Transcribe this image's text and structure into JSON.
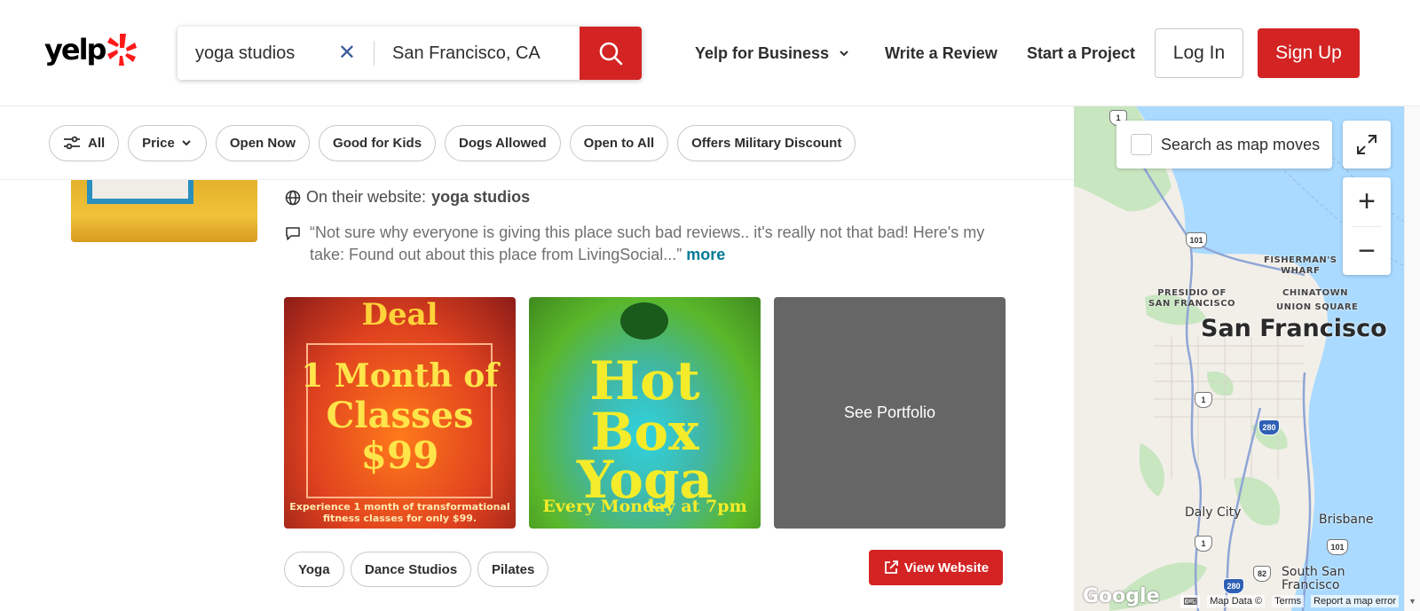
{
  "header": {
    "logo": "yelp",
    "search_find_value": "yoga studios",
    "search_near_value": "San Francisco, CA",
    "nav_business": "Yelp for Business",
    "nav_review": "Write a Review",
    "nav_project": "Start a Project",
    "login": "Log In",
    "signup": "Sign Up"
  },
  "filters": [
    "All",
    "Price",
    "Open Now",
    "Good for Kids",
    "Dogs Allowed",
    "Open to All",
    "Offers Military Discount"
  ],
  "listing": {
    "website_prefix": "On their website:",
    "website_term": "yoga studios",
    "quote": "“Not sure why everyone is giving this place such bad reviews.. it's really not that bad! Here's my take: Found out about this place from LivingSocial...”",
    "more": "more",
    "photo1": {
      "line0": "Deal",
      "line1": "1 Month of",
      "line2": "Classes",
      "line3": "$99",
      "small": "Experience 1 month of transformational fitness classes for only $99."
    },
    "photo2": {
      "line1": "Hot",
      "line2": "Box",
      "line3": "Yoga",
      "small": "Every Monday at 7pm"
    },
    "see_portfolio": "See Portfolio",
    "tags": [
      "Yoga",
      "Dance Studios",
      "Pilates"
    ],
    "view_website": "View Website"
  },
  "map": {
    "search_as_moves": "Search as map moves",
    "zoom_in": "+",
    "zoom_out": "−",
    "labels": {
      "fishermans_wharf": "FISHERMAN'S\nWHARF",
      "presidio": "PRESIDIO OF\nSAN FRANCISCO",
      "chinatown": "CHINATOWN",
      "union_square": "UNION SQUARE",
      "city": "San Francisco",
      "daly_city": "Daly City",
      "brisbane": "Brisbane",
      "south_sf": "South San\nFrancisco"
    },
    "shields": [
      "1",
      "101",
      "1",
      "280",
      "1",
      "101",
      "82",
      "280"
    ],
    "google": "Google",
    "footer": [
      "Map Data ©",
      "Terms",
      "Report a map error"
    ]
  },
  "colors": {
    "brand_red": "#d32323",
    "link_teal": "#027a97",
    "water": "#aadaff"
  }
}
